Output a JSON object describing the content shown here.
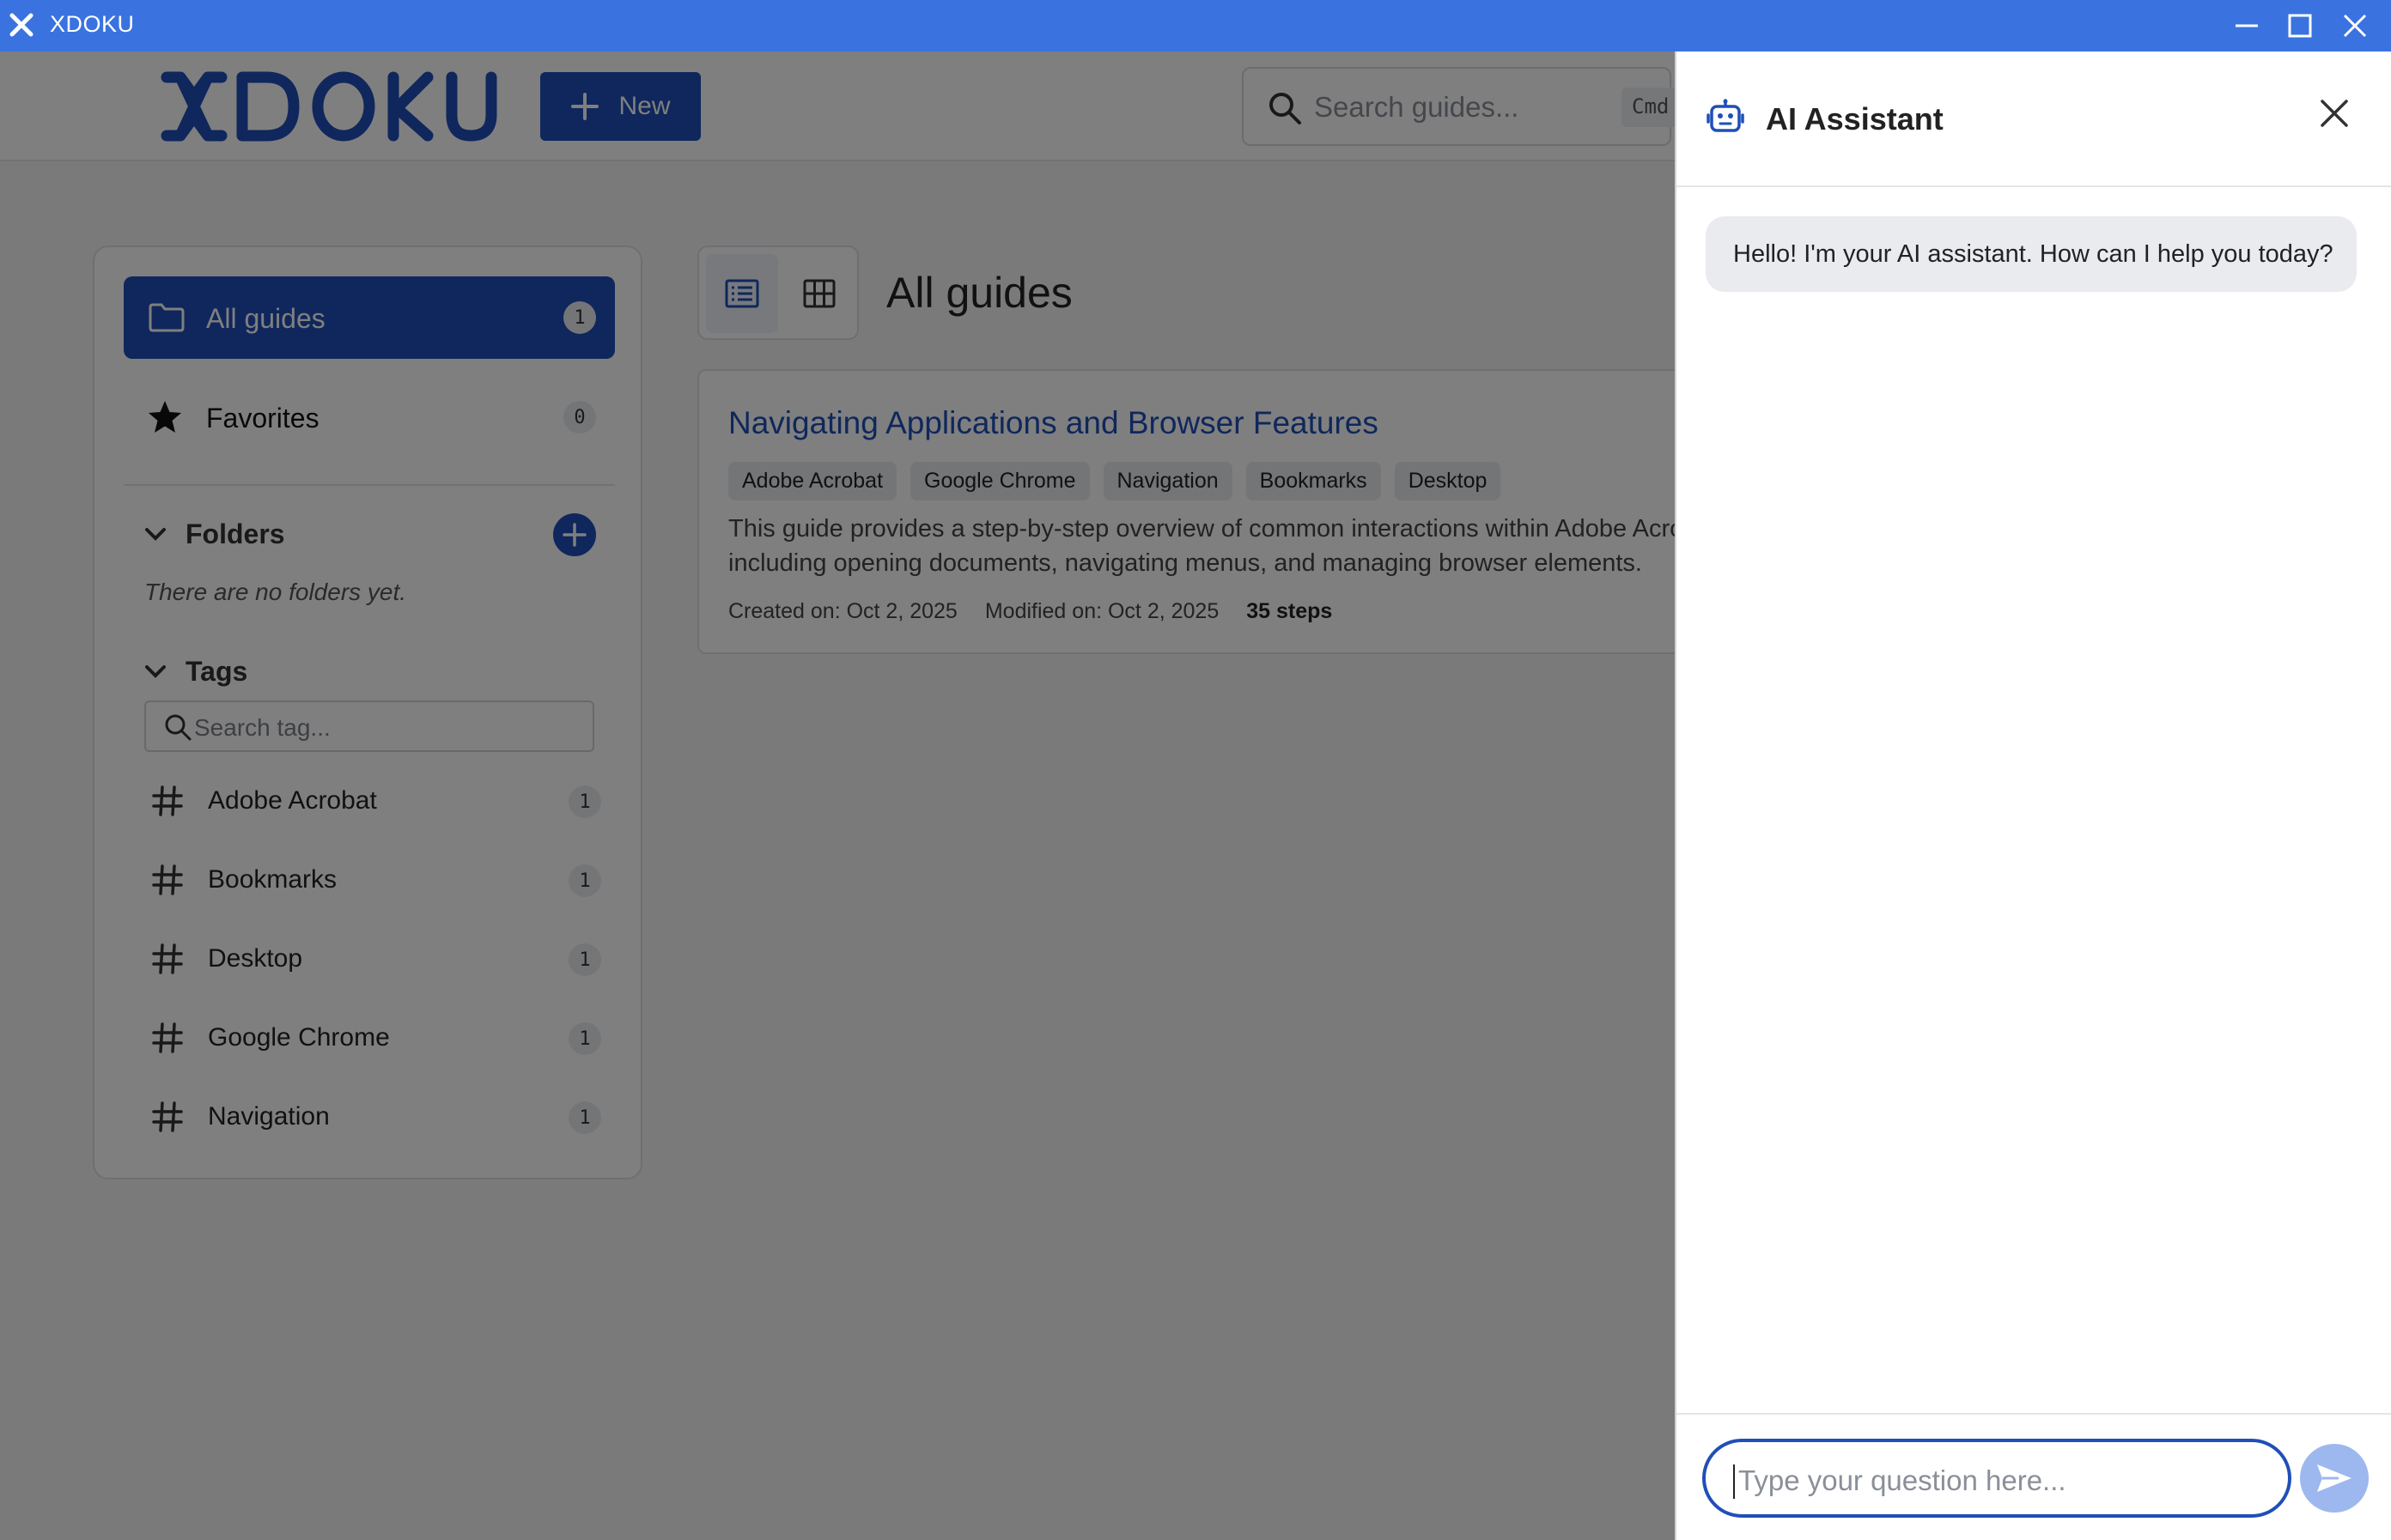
{
  "window": {
    "title": "XDOKU"
  },
  "header": {
    "logo_text": "XDOKU",
    "new_label": "New",
    "search_placeholder": "Search guides...",
    "search_shortcut": "Cmd"
  },
  "sidebar": {
    "all_guides": {
      "label": "All guides",
      "count": "1"
    },
    "favorites": {
      "label": "Favorites",
      "count": "0"
    },
    "folders": {
      "title": "Folders",
      "empty_text": "There are no folders yet."
    },
    "tags": {
      "title": "Tags",
      "search_placeholder": "Search tag...",
      "items": [
        {
          "name": "Adobe Acrobat",
          "count": "1"
        },
        {
          "name": "Bookmarks",
          "count": "1"
        },
        {
          "name": "Desktop",
          "count": "1"
        },
        {
          "name": "Google Chrome",
          "count": "1"
        },
        {
          "name": "Navigation",
          "count": "1"
        }
      ]
    }
  },
  "main": {
    "title": "All guides",
    "guides": [
      {
        "title": "Navigating Applications and Browser Features",
        "tags": [
          "Adobe Acrobat",
          "Google Chrome",
          "Navigation",
          "Bookmarks",
          "Desktop"
        ],
        "description_line1": "This guide provides a step-by-step overview of common interactions within Adobe Acrobat",
        "description_line2": "including opening documents, navigating menus, and managing browser elements.",
        "created": "Created on: Oct 2, 2025",
        "modified": "Modified on: Oct 2, 2025",
        "steps": "35 steps"
      }
    ]
  },
  "ai_panel": {
    "title": "AI Assistant",
    "messages": [
      {
        "role": "assistant",
        "text": "Hello! I'm your AI assistant. How can I help you today?"
      }
    ],
    "input_placeholder": "Type your question here..."
  },
  "colors": {
    "titlebar": "#3a73e0",
    "primary": "#1f4fb8",
    "send_button": "#9db8ef"
  }
}
